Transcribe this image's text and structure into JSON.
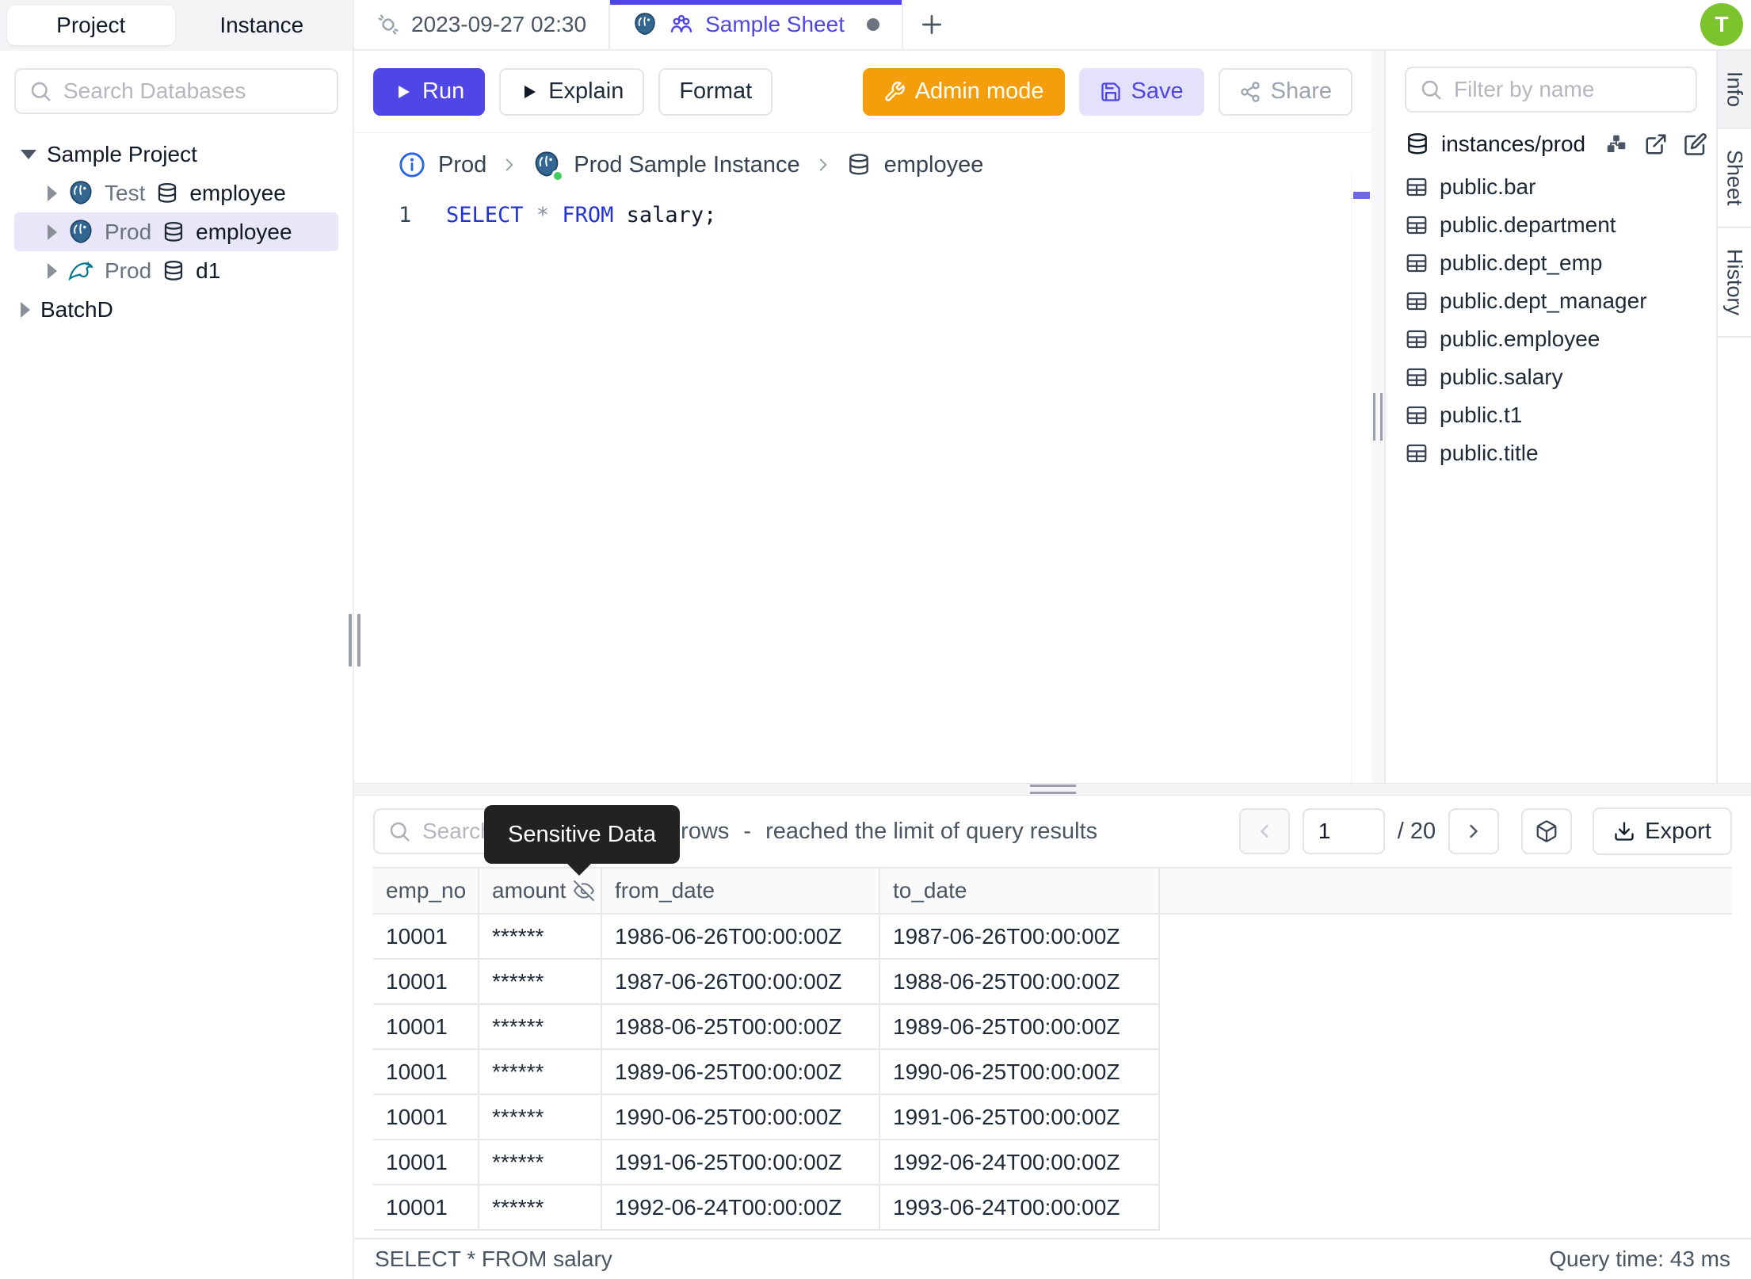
{
  "colors": {
    "accent_indigo": "#4F46E5",
    "admin_orange": "#F59E0B",
    "save_button_bg": "#E4E2FB",
    "avatar_green": "#7CC32C",
    "keyword_blue": "#2332D8",
    "tooltip_bg": "#222222",
    "selected_tree_bg": "#E8E6F8",
    "instance_status_green": "#3FCF63"
  },
  "sidebar": {
    "tabs": [
      {
        "label": "Project"
      },
      {
        "label": "Instance"
      }
    ],
    "search_placeholder": "Search Databases",
    "tree": {
      "project1": "Sample Project",
      "items": [
        {
          "env": "Test",
          "db": "employee",
          "engine": "postgres"
        },
        {
          "env": "Prod",
          "db": "employee",
          "engine": "postgres"
        },
        {
          "env": "Prod",
          "db": "d1",
          "engine": "mysql"
        }
      ],
      "project2": "BatchD"
    }
  },
  "tabbar": {
    "history_tab": "2023-09-27 02:30",
    "sheet_tab": "Sample Sheet",
    "avatar_initial": "T"
  },
  "toolbar": {
    "run_label": "Run",
    "explain_label": "Explain",
    "format_label": "Format",
    "admin_label": "Admin mode",
    "save_label": "Save",
    "share_label": "Share"
  },
  "breadcrumb": {
    "env": "Prod",
    "instance": "Prod Sample Instance",
    "database": "employee"
  },
  "editor": {
    "line_number": "1",
    "keyword_select": "SELECT",
    "star": "*",
    "keyword_from": "FROM",
    "identifier": "salary;"
  },
  "right_panel": {
    "filter_placeholder": "Filter by name",
    "group_label": "instances/prod",
    "tables": [
      {
        "name": "public.bar"
      },
      {
        "name": "public.department"
      },
      {
        "name": "public.dept_emp"
      },
      {
        "name": "public.dept_manager"
      },
      {
        "name": "public.employee"
      },
      {
        "name": "public.salary"
      },
      {
        "name": "public.t1"
      },
      {
        "name": "public.title"
      }
    ],
    "vertical_tabs": [
      {
        "label": "Info"
      },
      {
        "label": "Sheet"
      },
      {
        "label": "History"
      }
    ]
  },
  "results": {
    "search_placeholder": "Search",
    "tooltip": "Sensitive Data",
    "row_count": "0 rows",
    "dash": "-",
    "limit_message": "reached the limit of query results",
    "page": "1",
    "page_total": "/ 20",
    "export_label": "Export",
    "columns": [
      "emp_no",
      "amount",
      "from_date",
      "to_date"
    ],
    "rows": [
      {
        "emp_no": "10001",
        "amount": "******",
        "from_date": "1986-06-26T00:00:00Z",
        "to_date": "1987-06-26T00:00:00Z"
      },
      {
        "emp_no": "10001",
        "amount": "******",
        "from_date": "1987-06-26T00:00:00Z",
        "to_date": "1988-06-25T00:00:00Z"
      },
      {
        "emp_no": "10001",
        "amount": "******",
        "from_date": "1988-06-25T00:00:00Z",
        "to_date": "1989-06-25T00:00:00Z"
      },
      {
        "emp_no": "10001",
        "amount": "******",
        "from_date": "1989-06-25T00:00:00Z",
        "to_date": "1990-06-25T00:00:00Z"
      },
      {
        "emp_no": "10001",
        "amount": "******",
        "from_date": "1990-06-25T00:00:00Z",
        "to_date": "1991-06-25T00:00:00Z"
      },
      {
        "emp_no": "10001",
        "amount": "******",
        "from_date": "1991-06-25T00:00:00Z",
        "to_date": "1992-06-24T00:00:00Z"
      },
      {
        "emp_no": "10001",
        "amount": "******",
        "from_date": "1992-06-24T00:00:00Z",
        "to_date": "1993-06-24T00:00:00Z"
      }
    ]
  },
  "statusbar": {
    "statement": "SELECT * FROM salary",
    "query_time": "Query time: 43 ms"
  }
}
